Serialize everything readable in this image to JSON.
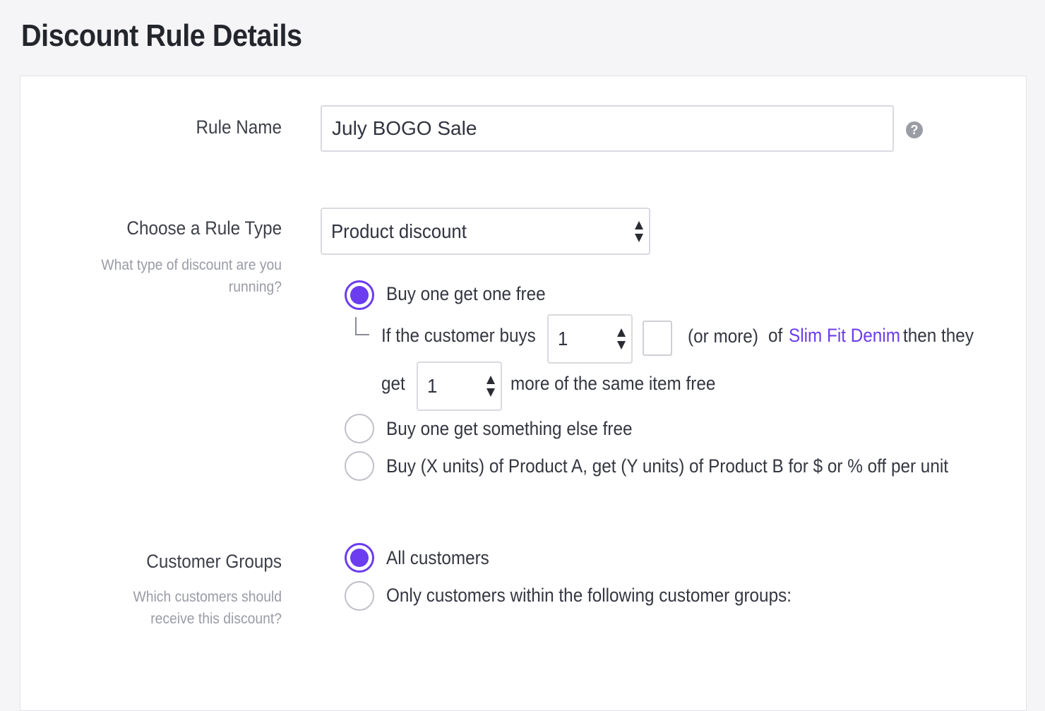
{
  "page": {
    "title": "Discount Rule Details"
  },
  "rule_name": {
    "label": "Rule Name",
    "value": "July BOGO Sale",
    "help_icon": "question-circle-icon"
  },
  "rule_type": {
    "label": "Choose a Rule Type",
    "hint": "What type of discount are you running?",
    "selected": "Product discount",
    "options": [
      {
        "label": "Buy one get one free",
        "checked": true
      },
      {
        "label": "Buy one get something else free",
        "checked": false
      },
      {
        "label": "Buy (X units) of Product A, get (Y units) of Product B for $ or % off per unit",
        "checked": false
      }
    ],
    "bogo_details": {
      "if_buys_text": "If the customer buys",
      "buy_quantity": "1",
      "or_more_text": "(or more)",
      "of_text": "of",
      "product_link": "Slim Fit Denim",
      "then_text": "then they",
      "get_text": "get",
      "get_quantity": "1",
      "same_item_text": "more of the same item free"
    }
  },
  "customer_groups": {
    "label": "Customer Groups",
    "hint": "Which customers should receive this discount?",
    "options": [
      {
        "label": "All customers",
        "checked": true
      },
      {
        "label": "Only customers within the following customer groups:",
        "checked": false
      }
    ]
  },
  "colors": {
    "accent": "#6b3cf0",
    "text": "#313440",
    "hint": "#9a9ca6",
    "border": "#d9dae0"
  }
}
